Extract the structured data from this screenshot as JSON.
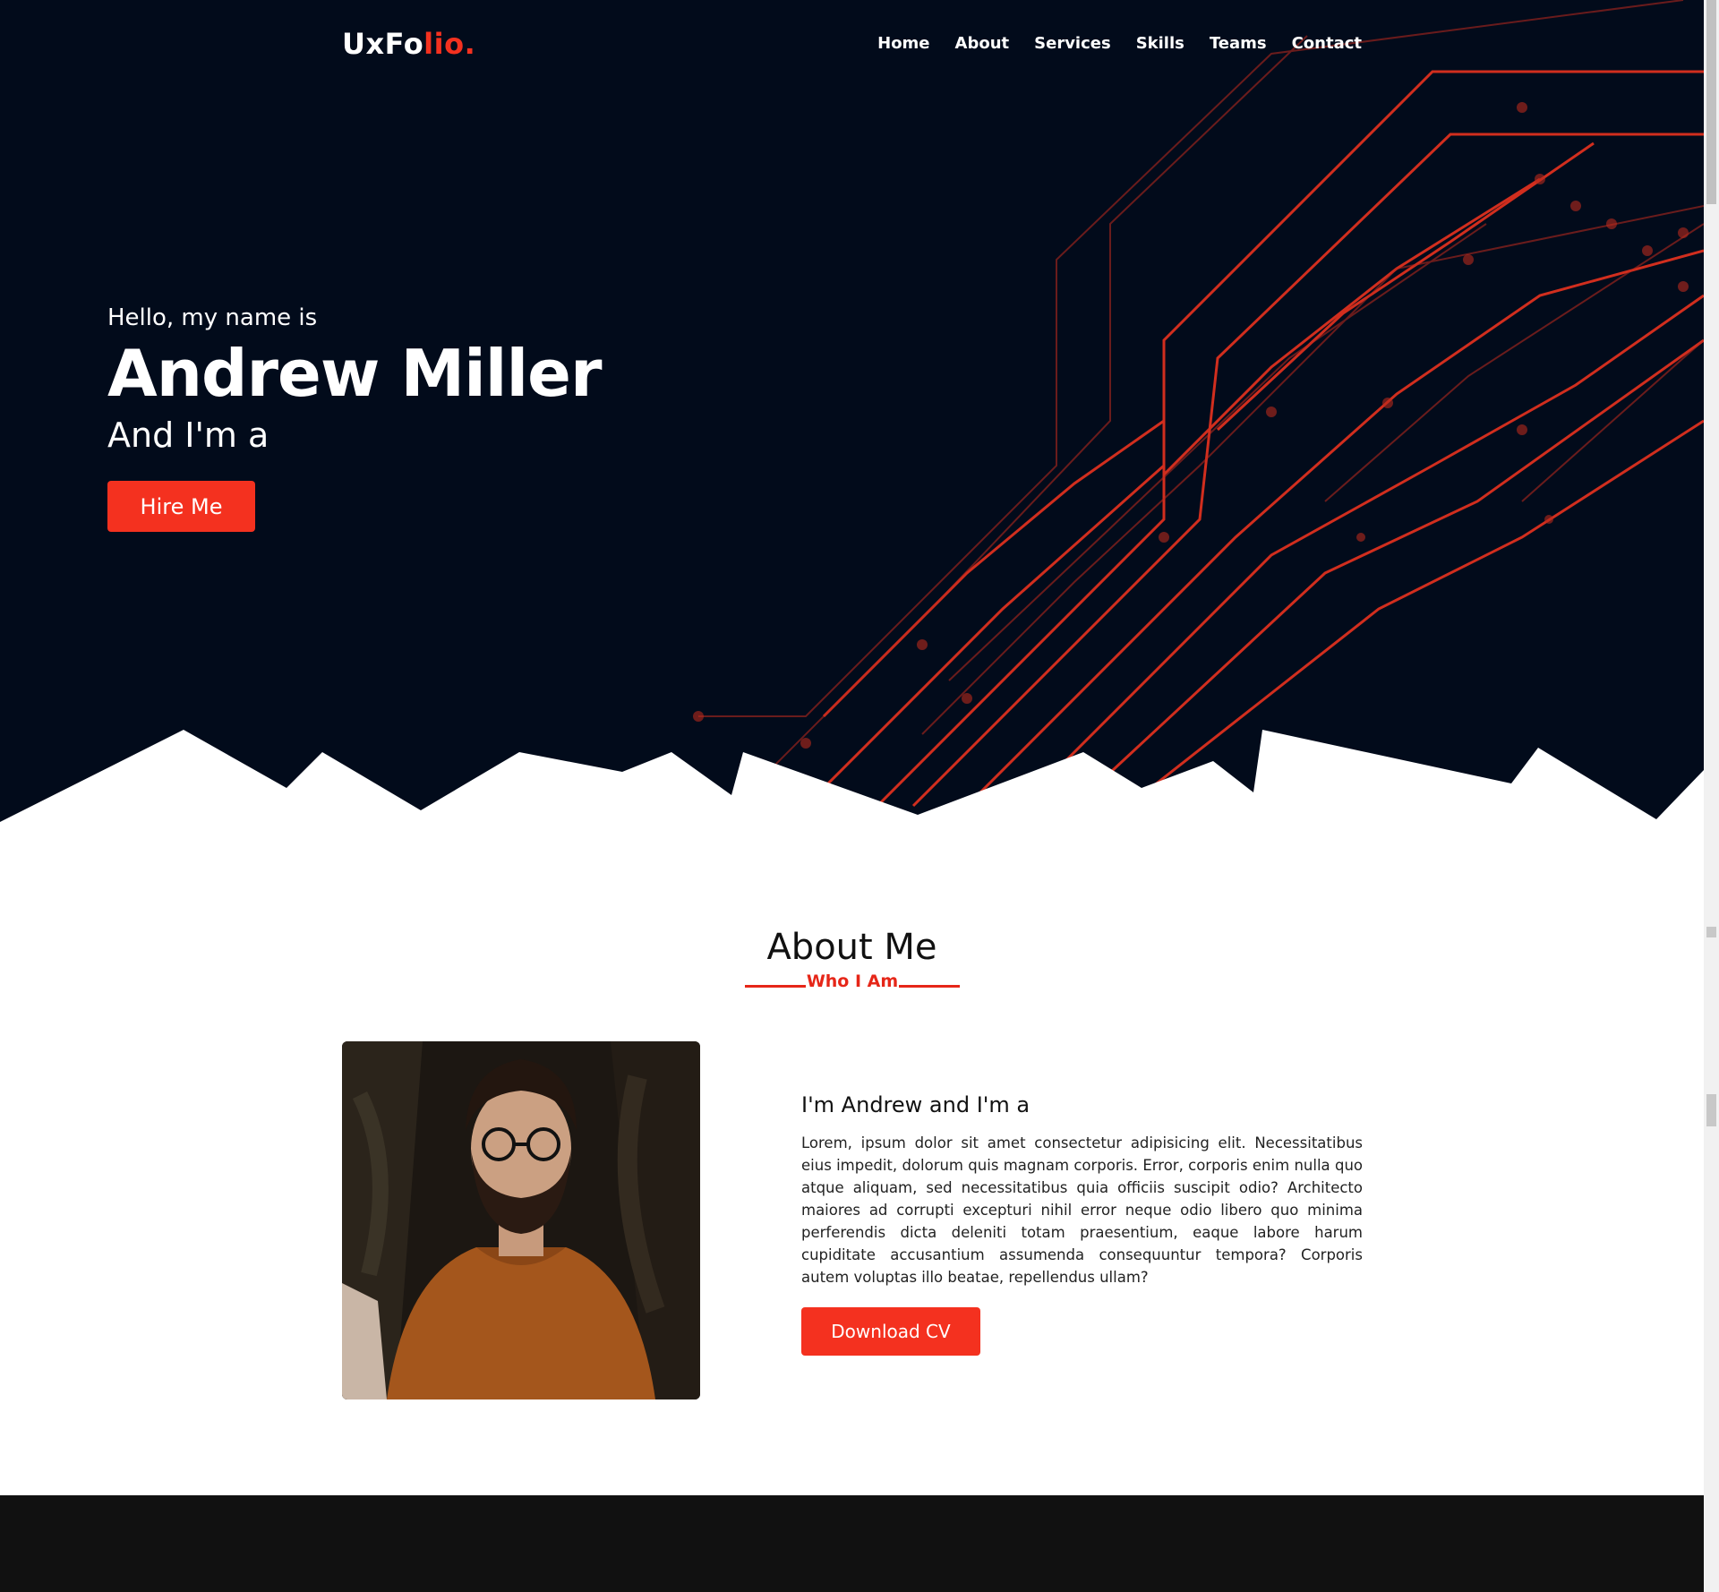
{
  "brand": {
    "logo_main": "UxFo",
    "logo_accent": "lio."
  },
  "nav": {
    "items": [
      "Home",
      "About",
      "Services",
      "Skills",
      "Teams",
      "Contact"
    ]
  },
  "hero": {
    "greeting": "Hello, my name is",
    "name": "Andrew Miller",
    "role_prefix": "And I'm a",
    "cta": "Hire Me"
  },
  "about": {
    "title": "About Me",
    "subtitle": "Who I Am",
    "heading": "I'm Andrew and I'm a",
    "body": "Lorem, ipsum dolor sit amet consectetur adipisicing elit. Necessitatibus eius impedit, dolorum quis magnam corporis. Error, corporis enim nulla quo atque aliquam, sed necessitatibus quia officiis suscipit odio? Architecto maiores ad corrupti excepturi nihil error neque odio libero quo minima perferendis dicta deleniti totam praesentium, eaque labore harum cupiditate accusantium assumenda consequuntur tempora? Corporis autem voluptas illo beatae, repellendus ullam?",
    "cv_button": "Download CV"
  },
  "colors": {
    "accent": "#f4311f",
    "hero_bg": "#020b1b",
    "footer_bg": "#111111"
  }
}
